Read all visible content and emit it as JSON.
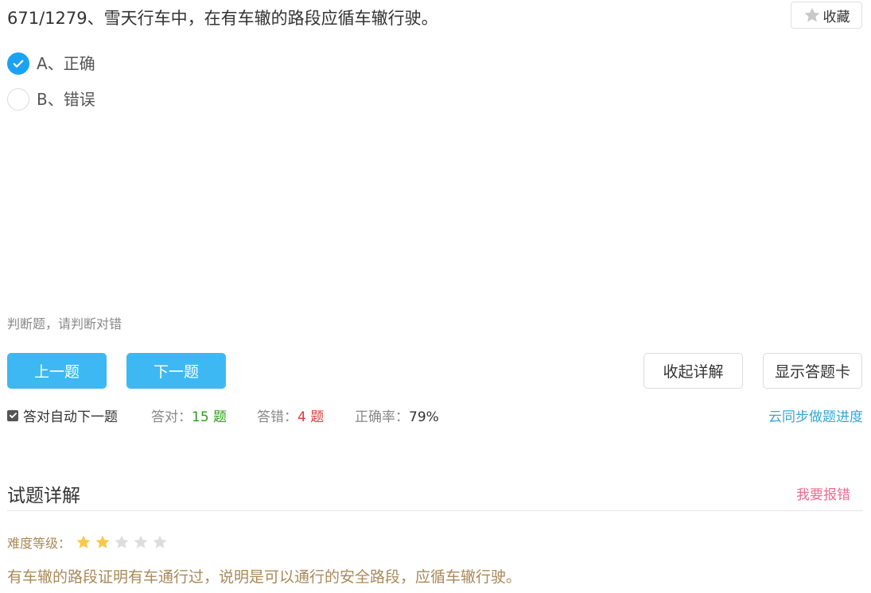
{
  "question": {
    "title": "671/1279、雪天行车中，在有车辙的路段应循车辙行驶。",
    "hint": "判断题，请判断对错"
  },
  "favorite": {
    "label": "收藏",
    "icon": "star-icon"
  },
  "options": [
    {
      "label": "A、正确",
      "checked": true
    },
    {
      "label": "B、错误",
      "checked": false
    }
  ],
  "buttons": {
    "prev": "上一题",
    "next": "下一题",
    "collapse": "收起详解",
    "show_card": "显示答题卡"
  },
  "stats": {
    "auto_next_label": "答对自动下一题",
    "auto_next_checked": true,
    "right_label": "答对：",
    "right_value": "15 题",
    "wrong_label": "答错：",
    "wrong_value": "4 题",
    "rate_label": "正确率：",
    "rate_value": "79%",
    "sync_label": "云同步做题进度"
  },
  "details": {
    "title": "试题详解",
    "report_label": "我要报错",
    "difficulty_label": "难度等级：",
    "difficulty_rating": 2,
    "difficulty_max": 5,
    "explanation": "有车辙的路段证明有车通行过，说明是可以通行的安全路段，应循车辙行驶。"
  },
  "colors": {
    "accent": "#3eb8f3",
    "check": "#1aa3f2",
    "star_on": "#f7c94a",
    "star_off": "#dddddd",
    "explanation": "#a88a5a"
  }
}
